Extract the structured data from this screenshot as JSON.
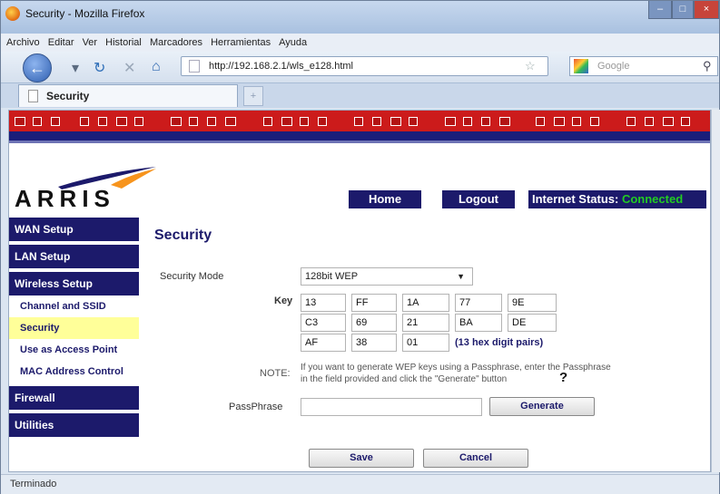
{
  "window": {
    "title": "Security - Mozilla Firefox",
    "controls": [
      "–",
      "□",
      "×"
    ]
  },
  "menu": [
    "Archivo",
    "Editar",
    "Ver",
    "Historial",
    "Marcadores",
    "Herramientas",
    "Ayuda"
  ],
  "nav": {
    "url": "http://192.168.2.1/wls_e128.html",
    "search_placeholder": "Google"
  },
  "tab": {
    "label": "Security",
    "new_tab": "+"
  },
  "brand": {
    "logo": "ARRIS",
    "header_color": "#cc1b1b",
    "nav_color": "#1c1a6b"
  },
  "top_buttons": {
    "home": "Home",
    "logout": "Logout",
    "internet_status_label": "Internet Status:",
    "internet_status_value": "Connected",
    "status_color": "#22cc22"
  },
  "sidebar": {
    "wan": "WAN Setup",
    "lan": "LAN Setup",
    "wireless": "Wireless Setup",
    "wireless_items": [
      "Channel and SSID",
      "Security",
      "Use as Access Point",
      "MAC Address Control"
    ],
    "firewall": "Firewall",
    "utilities": "Utilities"
  },
  "page": {
    "title": "Security",
    "security_mode_label": "Security Mode",
    "security_mode_value": "128bit WEP",
    "key_label": "Key",
    "key_rows": [
      [
        "13",
        "FF",
        "1A",
        "77",
        "9E"
      ],
      [
        "C3",
        "69",
        "21",
        "BA",
        "DE"
      ],
      [
        "AF",
        "38",
        "01"
      ]
    ],
    "key_hint": "(13 hex digit pairs)",
    "note_label": "NOTE:",
    "note_text_1": "If you want to generate WEP keys using a Passphrase, enter the Passphrase",
    "note_text_2": "in the field provided and click the \"Generate\" button",
    "help": "?",
    "passphrase_label": "PassPhrase",
    "passphrase_value": "",
    "generate": "Generate",
    "save": "Save",
    "cancel": "Cancel"
  },
  "status": "Terminado"
}
